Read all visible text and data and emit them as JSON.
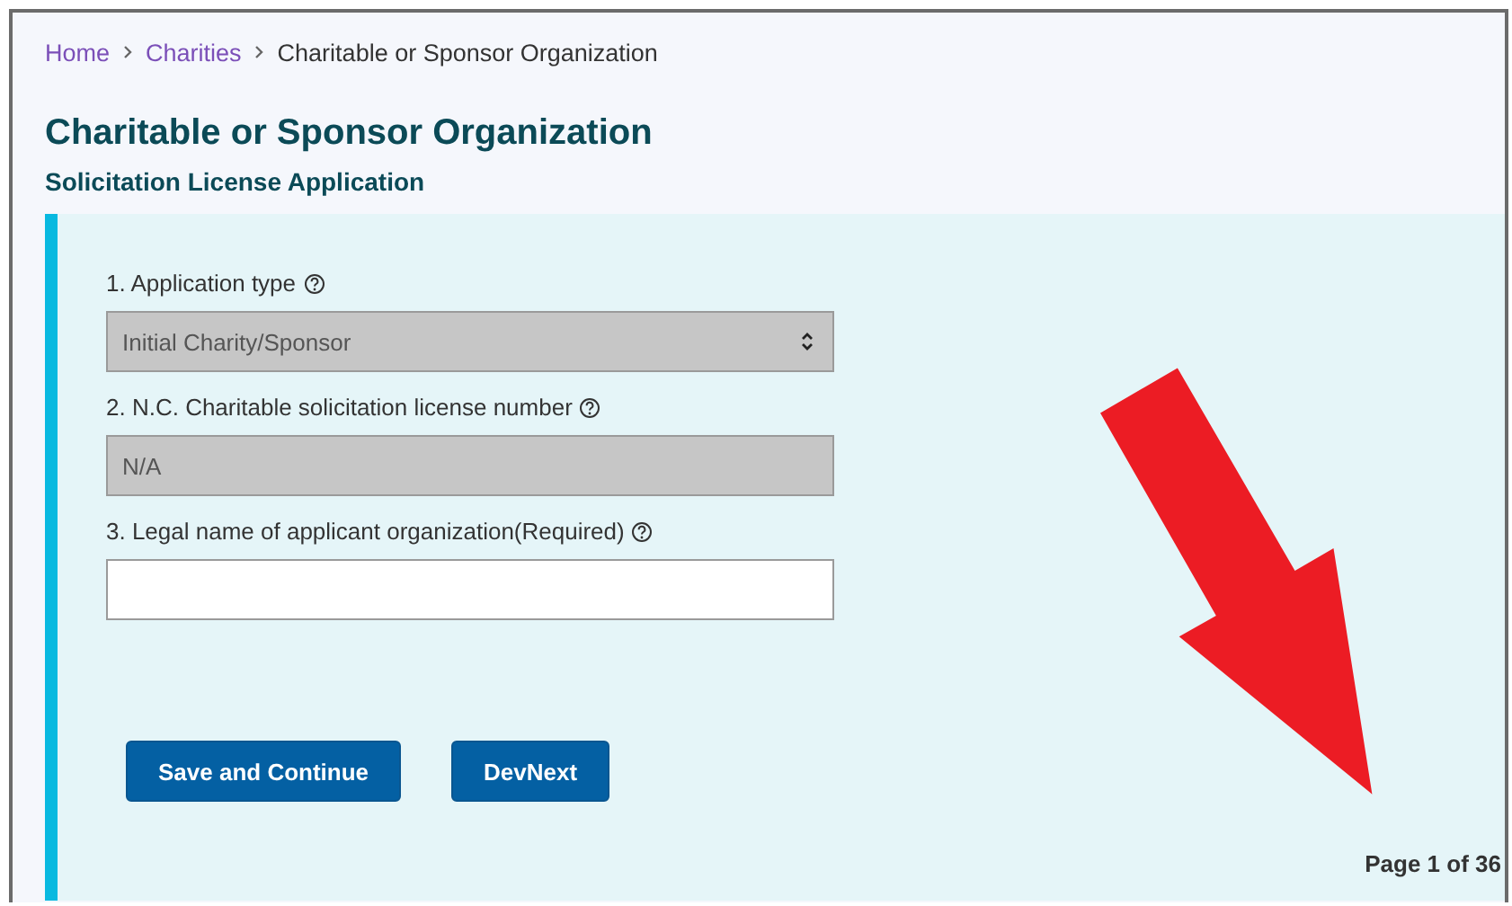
{
  "breadcrumb": [
    {
      "label": "Home",
      "kind": "link"
    },
    {
      "label": "Charities",
      "kind": "link"
    },
    {
      "label": "Charitable or Sponsor Organization",
      "kind": "current"
    }
  ],
  "title": "Charitable or Sponsor Organization",
  "subtitle": "Solicitation License Application",
  "fields": [
    {
      "label": "1. Application type",
      "kind": "select",
      "value": "Initial Charity/Sponsor",
      "disabled": true
    },
    {
      "label": "2. N.C. Charitable solicitation license number",
      "kind": "text",
      "value": "N/A",
      "disabled": true
    },
    {
      "label": "3. Legal name of applicant organization(Required)",
      "kind": "text",
      "disabled": false
    }
  ],
  "buttons": [
    "Save and Continue",
    "DevNext"
  ],
  "page_indicator": "Page 1 of 36"
}
